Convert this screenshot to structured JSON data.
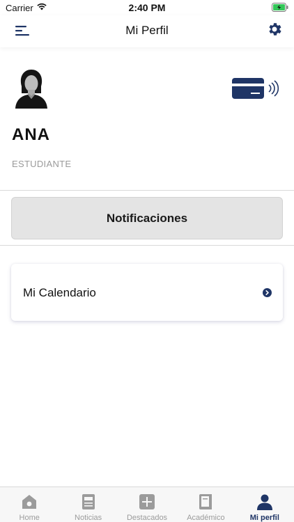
{
  "status_bar": {
    "carrier": "Carrier",
    "time": "2:40 PM"
  },
  "nav": {
    "title": "Mi Perfil"
  },
  "profile": {
    "name": "ANA",
    "role": "ESTUDIANTE"
  },
  "notifications": {
    "label": "Notificaciones"
  },
  "calendar": {
    "label": "Mi Calendario"
  },
  "tabs": [
    {
      "label": "Home",
      "icon": "home-icon"
    },
    {
      "label": "Noticias",
      "icon": "news-icon"
    },
    {
      "label": "Destacados",
      "icon": "plus-icon"
    },
    {
      "label": "Académico",
      "icon": "book-icon"
    },
    {
      "label": "Mi perfil",
      "icon": "person-icon",
      "active": true
    }
  ],
  "colors": {
    "accent": "#1f3566",
    "inactive": "#9b9b9b",
    "battery": "#34c759"
  }
}
